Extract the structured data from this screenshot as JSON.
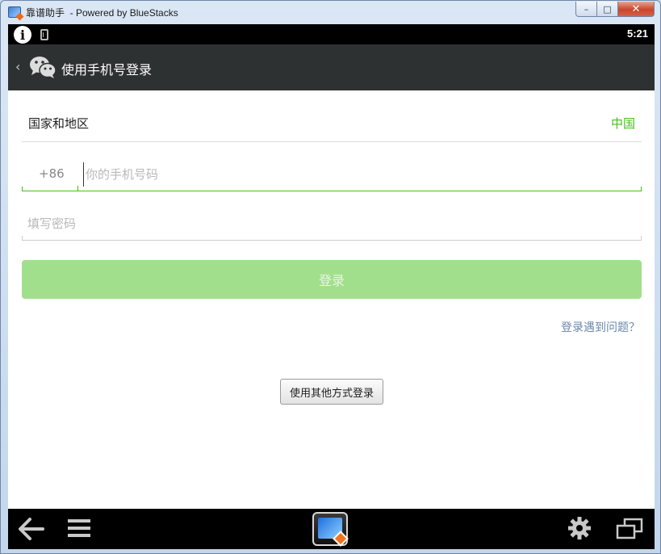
{
  "window": {
    "title": "靠谱助手  - Powered by BlueStacks",
    "minimize_glyph": "–",
    "maximize_glyph": "□",
    "close_glyph": "✕"
  },
  "statusbar": {
    "info_glyph": "i",
    "time": "5:21"
  },
  "actionbar": {
    "back_glyph": "‹",
    "title": "使用手机号登录",
    "icon": "wechat-icon",
    "bg_color": "#2e3132"
  },
  "form": {
    "region_label": "国家和地区",
    "region_value": "中国",
    "country_code": "+86",
    "phone_placeholder": "你的手机号码",
    "phone_value": "",
    "password_placeholder": "填写密码",
    "password_value": "",
    "login_label": "登录",
    "trouble_link": "登录遇到问题？",
    "other_login_label": "使用其他方式登录",
    "accent_color": "#45c01a",
    "login_button_color": "#a2df8d"
  },
  "navbar": {
    "icons": [
      "back-arrow-icon",
      "menu-icon",
      "bluestacks-home-icon",
      "settings-gear-icon",
      "window-switch-icon"
    ]
  }
}
